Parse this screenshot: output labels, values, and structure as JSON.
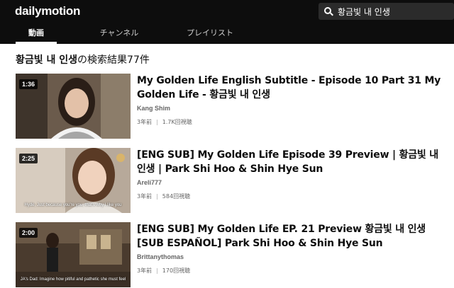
{
  "header": {
    "logo": "dailymotion",
    "search": {
      "value": "황금빛 내 인생",
      "placeholder": ""
    }
  },
  "tabs": [
    {
      "label": "動画",
      "active": true
    },
    {
      "label": "チャンネル",
      "active": false
    },
    {
      "label": "プレイリスト",
      "active": false
    }
  ],
  "results_heading": {
    "query": "황금빛 내 인생",
    "suffix": "の検索結果77件"
  },
  "results": [
    {
      "duration": "1:36",
      "title": "My Golden Life English Subtitle - Episode 10 Part 31 My Golden Life - 황금빛 내 인생",
      "channel": "Kang Shim",
      "age": "3年前",
      "views": "1.7K回視聴",
      "subtitle_overlay": ""
    },
    {
      "duration": "2:25",
      "title": "[ENG SUB] My Golden Life Episode 39 Preview | 황금빛 내 인생 | Park Shi Hoo & Shin Hye Sun",
      "channel": "Areli777",
      "age": "3年前",
      "views": "584回視聴",
      "subtitle_overlay": "Hyde, Just because you're you, that's why I like you"
    },
    {
      "duration": "2:00",
      "title": "[ENG SUB] My Golden Life EP. 21 Preview 황금빛 내 인생 [SUB ESPAÑOL] Park Shi Hoo & Shin Hye Sun",
      "channel": "Brittanythomas",
      "age": "3年前",
      "views": "170回視聴",
      "subtitle_overlay": "JA's Dad: Imagine how pitiful and pathetic she must feel"
    }
  ],
  "colors": {
    "topbar": "#0d0d0d",
    "search_bg": "#2b2b2b"
  }
}
